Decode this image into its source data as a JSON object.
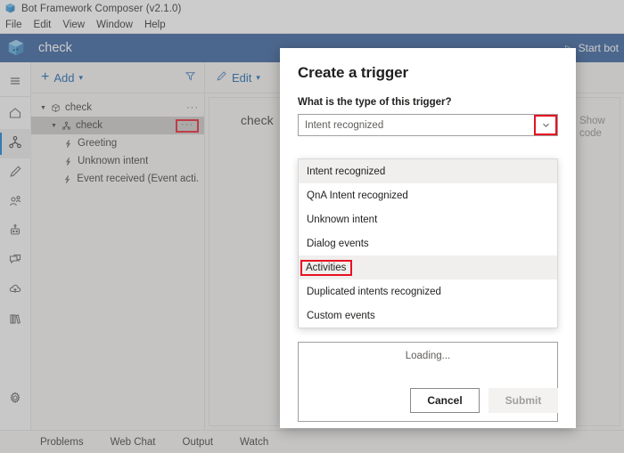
{
  "window": {
    "title": "Bot Framework Composer (v2.1.0)",
    "logo_icon": "composer-cube-icon"
  },
  "menu": {
    "items": [
      "File",
      "Edit",
      "View",
      "Window",
      "Help"
    ]
  },
  "appheader": {
    "logo_icon": "bot-cube-icon",
    "project_name": "check",
    "start_bot_label": "Start bot",
    "play_icon": "play-triangle-icon",
    "accent_color": "#2b5797"
  },
  "rail": {
    "items": [
      {
        "icon": "hamburger-menu-icon",
        "name": "menu-toggle"
      },
      {
        "icon": "home-icon",
        "name": "home"
      },
      {
        "icon": "design-nodes-icon",
        "name": "design"
      },
      {
        "icon": "bot-responses-icon",
        "name": "bot-responses"
      },
      {
        "icon": "user-input-icon",
        "name": "user-input"
      },
      {
        "icon": "diagnostics-robot-icon",
        "name": "diagnostics"
      },
      {
        "icon": "chat-bubbles-icon",
        "name": "conversations"
      },
      {
        "icon": "publish-cloud-icon",
        "name": "publish"
      },
      {
        "icon": "library-books-icon",
        "name": "package-library"
      }
    ],
    "settings": {
      "icon": "gear-icon",
      "name": "settings"
    }
  },
  "tree_toolbar": {
    "add_label": "Add",
    "add_icon": "plus-icon",
    "add_chevron": "chevron-down-icon",
    "filter_icon": "funnel-filter-icon"
  },
  "edit_toolbar": {
    "edit_label": "Edit",
    "edit_icon": "pencil-icon",
    "edit_chevron": "chevron-down-icon"
  },
  "tree": {
    "items": [
      {
        "label": "check",
        "icon": "bot-project-icon",
        "indent": 0,
        "twist": "▼",
        "selected": false,
        "ellipsis": "···",
        "ellipsis_boxed": false
      },
      {
        "label": "check",
        "icon": "dialog-node-icon",
        "indent": 1,
        "twist": "▼",
        "selected": true,
        "ellipsis": "···",
        "ellipsis_boxed": true
      },
      {
        "label": "Greeting",
        "icon": "trigger-lightning-icon",
        "indent": 2,
        "twist": "",
        "selected": false,
        "ellipsis": "",
        "ellipsis_boxed": false
      },
      {
        "label": "Unknown intent",
        "icon": "trigger-lightning-icon",
        "indent": 2,
        "twist": "",
        "selected": false,
        "ellipsis": "",
        "ellipsis_boxed": false
      },
      {
        "label": "Event received (Event acti...",
        "icon": "trigger-lightning-icon",
        "indent": 2,
        "twist": "",
        "selected": false,
        "ellipsis": "",
        "ellipsis_boxed": false
      }
    ]
  },
  "canvas": {
    "node_label": "check",
    "show_code_label": "Show code"
  },
  "modal": {
    "title": "Create a trigger",
    "question_label": "What is the type of this trigger?",
    "combo_value": "Intent recognized",
    "combo_chevron": "chevron-down-icon",
    "combo_chevron_highlighted": true,
    "options": [
      {
        "label": "Intent recognized",
        "state": "selected"
      },
      {
        "label": "QnA Intent recognized",
        "state": "normal"
      },
      {
        "label": "Unknown intent",
        "state": "normal"
      },
      {
        "label": "Dialog events",
        "state": "normal"
      },
      {
        "label": "Activities",
        "state": "hover-highlighted"
      },
      {
        "label": "Duplicated intents recognized",
        "state": "normal"
      },
      {
        "label": "Custom events",
        "state": "normal"
      }
    ],
    "loading_text": "Loading...",
    "cancel_label": "Cancel",
    "submit_label": "Submit",
    "submit_disabled": true,
    "highlight_color": "#e81123"
  },
  "bottombar": {
    "tabs": [
      "Problems",
      "Web Chat",
      "Output",
      "Watch"
    ]
  }
}
